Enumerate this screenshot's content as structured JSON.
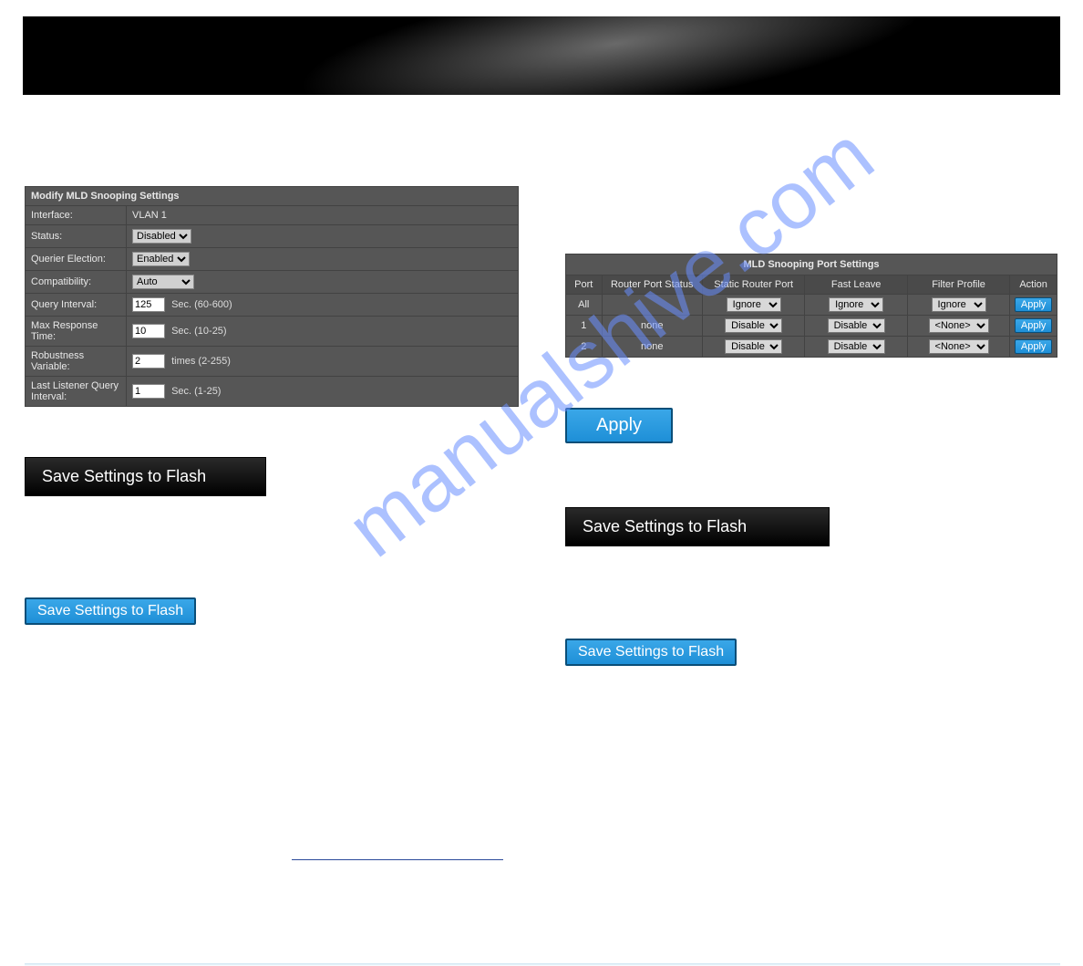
{
  "watermark": "manualshive.com",
  "modify": {
    "title": "Modify MLD Snooping Settings",
    "interface_label": "Interface:",
    "interface_value": "VLAN 1",
    "status_label": "Status:",
    "status_value": "Disabled",
    "querier_label": "Querier Election:",
    "querier_value": "Enabled",
    "compat_label": "Compatibility:",
    "compat_value": "Auto",
    "qi_label": "Query Interval:",
    "qi_value": "125",
    "qi_hint": "Sec. (60-600)",
    "mrt_label": "Max Response Time:",
    "mrt_value": "10",
    "mrt_hint": "Sec. (10-25)",
    "rv_label": "Robustness Variable:",
    "rv_value": "2",
    "rv_hint": "times (2-255)",
    "llqi_label": "Last Listener Query Interval:",
    "llqi_value": "1",
    "llqi_hint": "Sec. (1-25)"
  },
  "save_flash_label": "Save Settings to Flash",
  "port": {
    "title": "MLD Snooping Port Settings",
    "headers": [
      "Port",
      "Router Port Status",
      "Static Router Port",
      "Fast Leave",
      "Filter Profile",
      "Action"
    ],
    "rows": [
      {
        "port": "All",
        "router_status": "",
        "static": "Ignore",
        "fast": "Ignore",
        "filter": "Ignore",
        "action": "Apply"
      },
      {
        "port": "1",
        "router_status": "none",
        "static": "Disable",
        "fast": "Disable",
        "filter": "<None>",
        "action": "Apply"
      },
      {
        "port": "2",
        "router_status": "none",
        "static": "Disable",
        "fast": "Disable",
        "filter": "<None>",
        "action": "Apply"
      }
    ]
  },
  "apply_label": "Apply"
}
